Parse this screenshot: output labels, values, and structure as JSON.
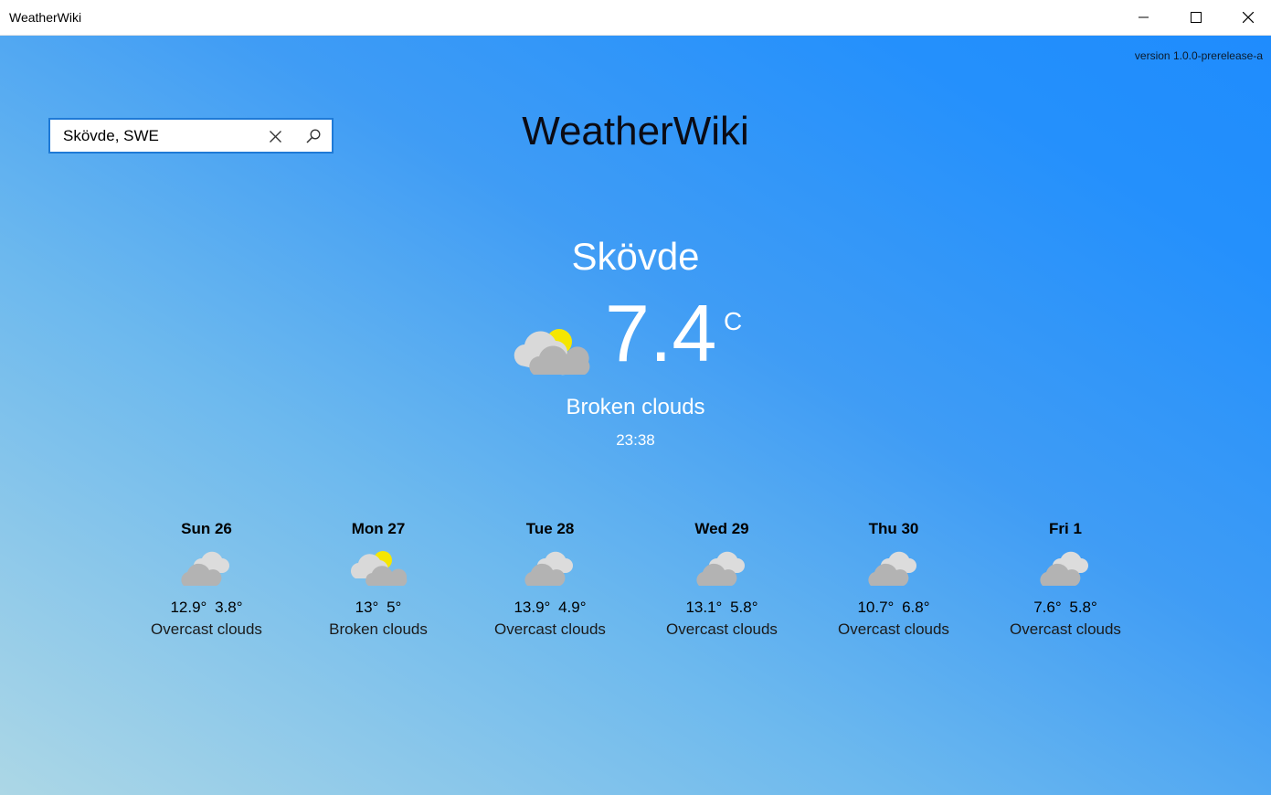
{
  "window": {
    "title": "WeatherWiki"
  },
  "header": {
    "version": "version 1.0.0-prerelease-a",
    "app_name": "WeatherWiki"
  },
  "search": {
    "value": "Skövde, SWE",
    "clear_icon": "close-icon",
    "search_icon": "search-icon"
  },
  "current": {
    "city": "Skövde",
    "temperature": "7.4",
    "unit": "C",
    "condition": "Broken clouds",
    "time": "23:38",
    "icon": "broken-clouds-icon"
  },
  "forecast": [
    {
      "day": "Sun 26",
      "high": "12.9°",
      "low": "3.8°",
      "desc": "Overcast clouds",
      "icon": "overcast-clouds-icon"
    },
    {
      "day": "Mon 27",
      "high": "13°",
      "low": "5°",
      "desc": "Broken clouds",
      "icon": "broken-clouds-icon"
    },
    {
      "day": "Tue 28",
      "high": "13.9°",
      "low": "4.9°",
      "desc": "Overcast clouds",
      "icon": "overcast-clouds-icon"
    },
    {
      "day": "Wed 29",
      "high": "13.1°",
      "low": "5.8°",
      "desc": "Overcast clouds",
      "icon": "overcast-clouds-icon"
    },
    {
      "day": "Thu 30",
      "high": "10.7°",
      "low": "6.8°",
      "desc": "Overcast clouds",
      "icon": "overcast-clouds-icon"
    },
    {
      "day": "Fri 1",
      "high": "7.6°",
      "low": "5.8°",
      "desc": "Overcast clouds",
      "icon": "overcast-clouds-icon"
    }
  ],
  "colors": {
    "accent": "#1f7ad6",
    "sun": "#f5e600",
    "cloud_light": "#d9d9d9",
    "cloud_dark": "#b3b3b3"
  }
}
